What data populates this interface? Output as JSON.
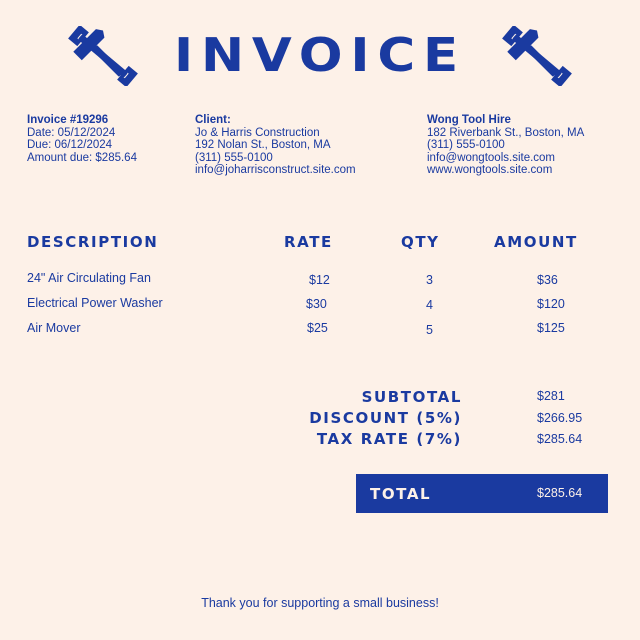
{
  "header": {
    "title": "INVOICE",
    "icon": "hammer-wrench-crossed-icon",
    "accent_color": "#1a3aa0",
    "background_color": "#fdf1e8"
  },
  "invoice_info": {
    "number": "Invoice #19296",
    "date": "Date: 05/12/2024",
    "due": "Due: 06/12/2024",
    "amount_due": "Amount due: $285.64"
  },
  "client": {
    "heading": "Client:",
    "name": "Jo & Harris Construction",
    "address": "192 Nolan St., Boston, MA",
    "phone": "(311) 555-0100",
    "email": "info@joharrisconstruct.site.com"
  },
  "company": {
    "name": "Wong Tool Hire",
    "address": "182 Riverbank St., Boston, MA",
    "phone": "(311) 555-0100",
    "email": "info@wongtools.site.com",
    "website": "www.wongtools.site.com"
  },
  "table": {
    "headers": {
      "description": "DESCRIPTION",
      "rate": "RATE",
      "qty": "QTY",
      "amount": "AMOUNT"
    },
    "rows": [
      {
        "description": "24\" Air Circulating Fan",
        "rate": "$12",
        "qty": "3",
        "amount": "$36"
      },
      {
        "description": "Electrical Power Washer",
        "rate": "$30",
        "qty": "4",
        "amount": "$120"
      },
      {
        "description": "Air Mover",
        "rate": "$25",
        "qty": "5",
        "amount": "$125"
      }
    ]
  },
  "summary": {
    "subtotal_label": "SUBTOTAL",
    "subtotal_value": "$281",
    "discount_label": "DISCOUNT (5%)",
    "discount_value": "$266.95",
    "tax_label": "TAX RATE (7%)",
    "tax_value": "$285.64",
    "total_label": "TOTAL",
    "total_value": "$285.64"
  },
  "footer": {
    "message": "Thank you for supporting a small business!"
  }
}
